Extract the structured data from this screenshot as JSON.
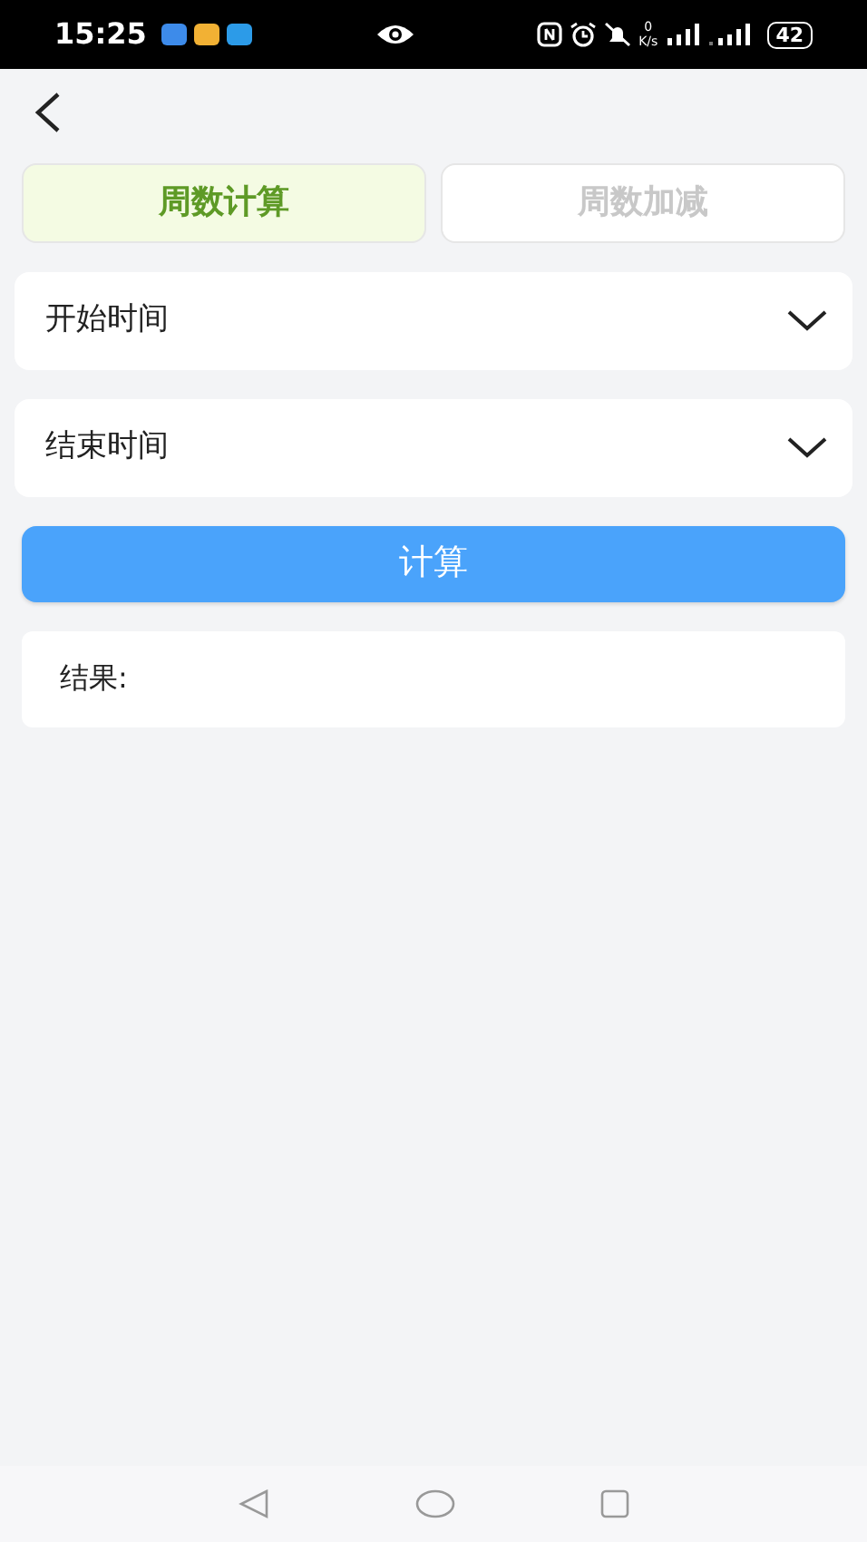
{
  "status_bar": {
    "time": "15:25",
    "speed_value": "0",
    "speed_unit": "K/s",
    "battery": "42"
  },
  "tabs": [
    {
      "label": "周数计算",
      "selected": true
    },
    {
      "label": "周数加减",
      "selected": false
    }
  ],
  "fields": [
    {
      "label": "开始时间"
    },
    {
      "label": "结束时间"
    }
  ],
  "calculate_button": "计算",
  "result": {
    "label": "结果:"
  }
}
